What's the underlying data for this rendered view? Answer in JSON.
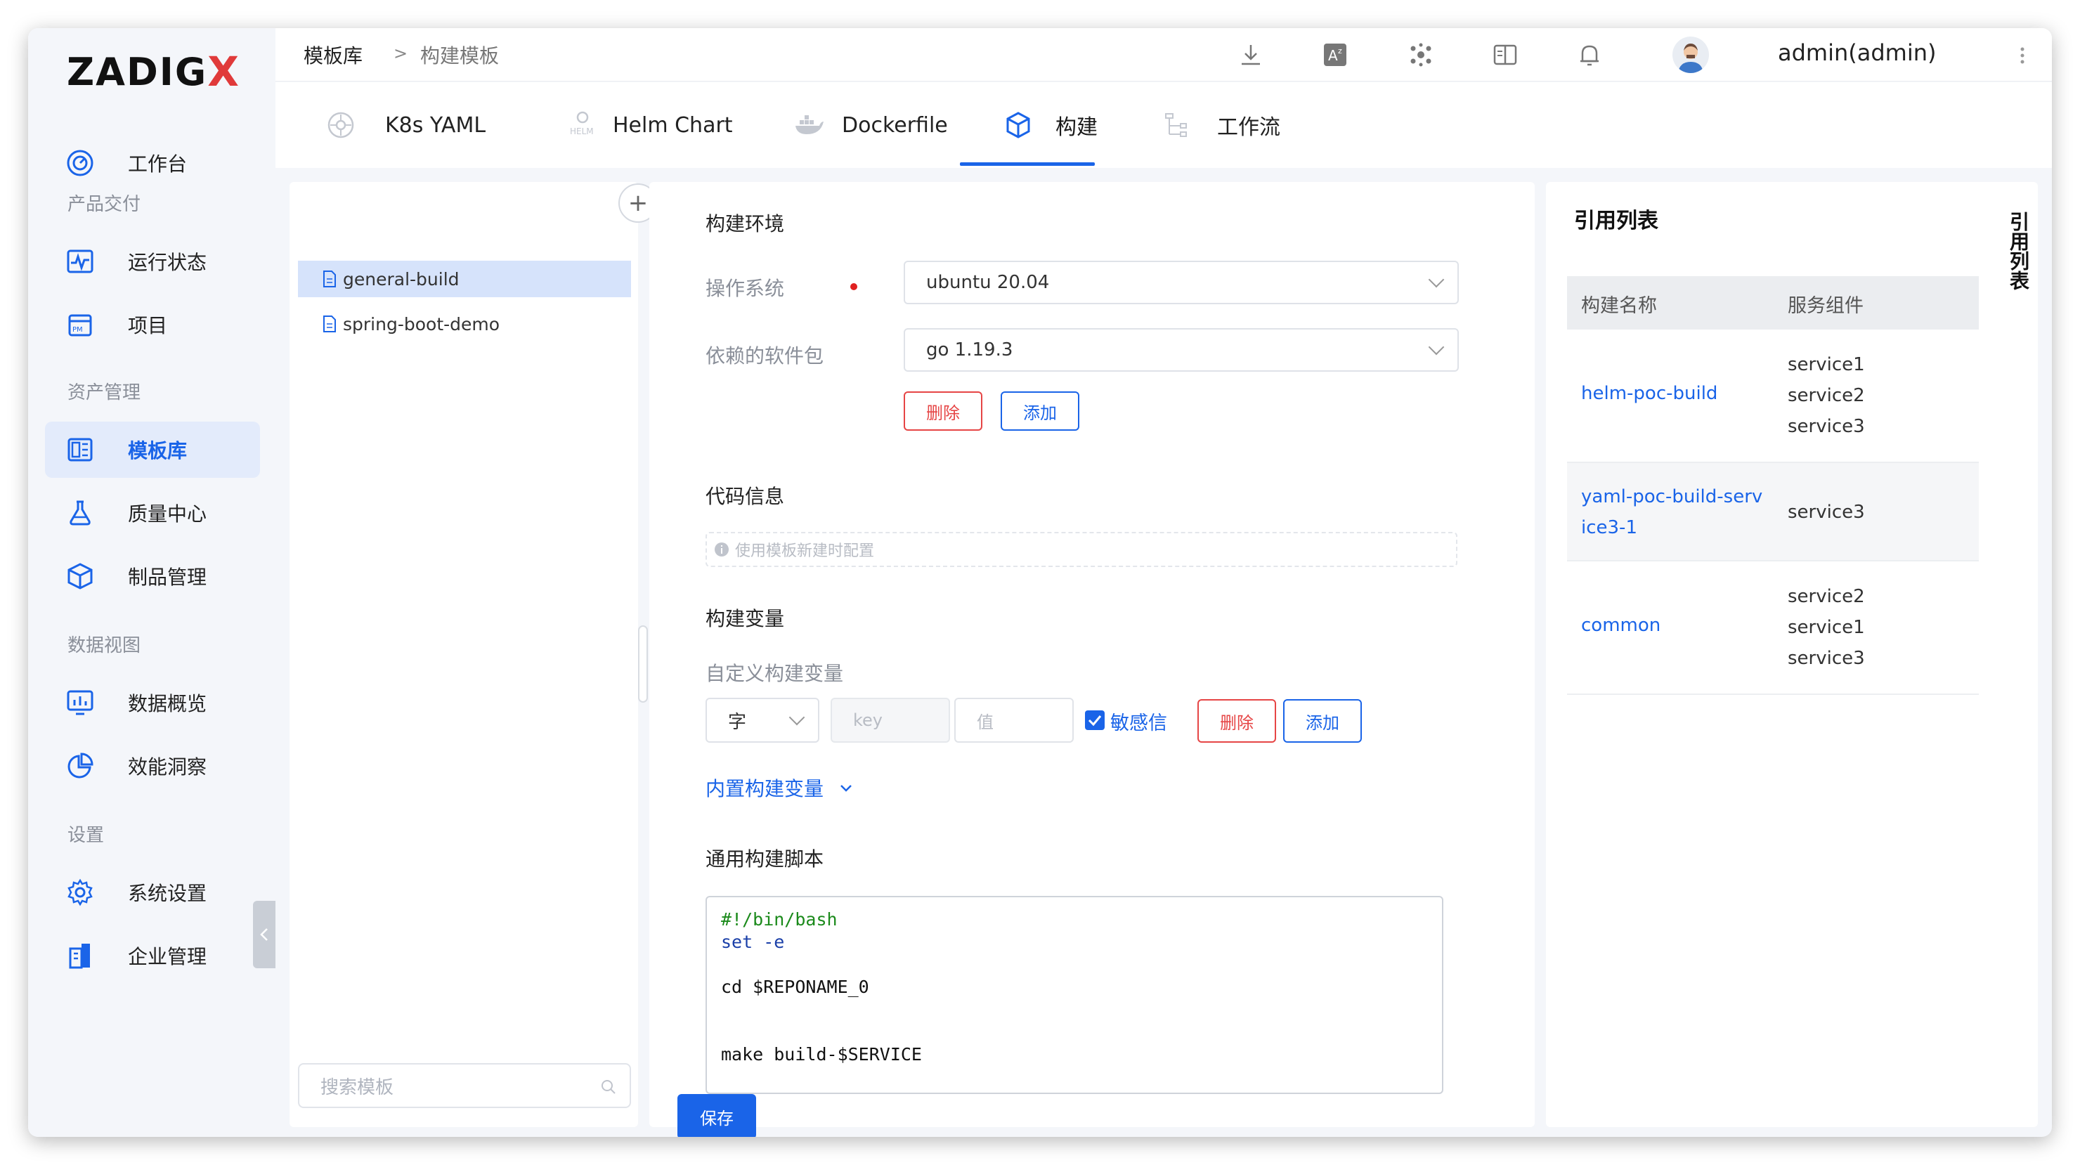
{
  "brand": {
    "logo_text": "ZADIG",
    "logo_x": "X"
  },
  "sidebar": {
    "items": [
      {
        "label": "工作台",
        "icon": "dashboard-icon"
      },
      {
        "section": "产品交付"
      },
      {
        "label": "运行状态",
        "icon": "pulse-icon"
      },
      {
        "label": "项目",
        "icon": "project-icon"
      },
      {
        "section": "资产管理"
      },
      {
        "label": "模板库",
        "icon": "template-icon",
        "active": true
      },
      {
        "label": "质量中心",
        "icon": "flask-icon"
      },
      {
        "label": "制品管理",
        "icon": "package-icon"
      },
      {
        "section": "数据视图"
      },
      {
        "label": "数据概览",
        "icon": "chart-icon"
      },
      {
        "label": "效能洞察",
        "icon": "pie-icon"
      },
      {
        "section": "设置"
      },
      {
        "label": "系统设置",
        "icon": "gear-icon"
      },
      {
        "label": "企业管理",
        "icon": "building-icon"
      }
    ]
  },
  "topbar": {
    "breadcrumb": [
      "模板库",
      ">",
      "构建模板"
    ],
    "user": "admin(admin)"
  },
  "tabs": [
    {
      "label": "K8s YAML",
      "icon": "k8s-icon"
    },
    {
      "label": "Helm Chart",
      "icon": "helm-icon"
    },
    {
      "label": "Dockerfile",
      "icon": "docker-icon"
    },
    {
      "label": "构建",
      "icon": "cube-icon",
      "active": true
    },
    {
      "label": "工作流",
      "icon": "workflow-icon"
    }
  ],
  "templates": {
    "add_symbol": "+",
    "items": [
      "general-build",
      "spring-boot-demo"
    ],
    "search_placeholder": "搜索模板"
  },
  "form": {
    "env_title": "构建环境",
    "os_label": "操作系统",
    "os_value": "ubuntu 20.04",
    "deps_label": "依赖的软件包",
    "deps_value": "go 1.19.3",
    "delete_label": "删除",
    "add_label": "添加",
    "code_title": "代码信息",
    "code_hint": "使用模板新建时配置",
    "vars_title": "构建变量",
    "custom_vars_label": "自定义构建变量",
    "var_type": "字",
    "var_key_placeholder": "key",
    "var_value_placeholder": "值",
    "sensitive_label": "敏感信",
    "builtin_vars_label": "内置构建变量",
    "script_title": "通用构建脚本",
    "script_lines": [
      "#!/bin/bash",
      "set -e",
      "",
      "cd $REPONAME_0",
      "",
      "",
      "make build-$SERVICE"
    ],
    "save_label": "保存"
  },
  "references": {
    "title": "引用列表",
    "side_tab": "引用列表",
    "headers": [
      "构建名称",
      "服务组件"
    ],
    "rows": [
      {
        "name": "helm-poc-build",
        "services": [
          "service1",
          "service2",
          "service3"
        ]
      },
      {
        "name": "yaml-poc-build-serv ice3-1",
        "name_lines": [
          "yaml-poc-build-serv",
          "ice3-1"
        ],
        "services": [
          "service3"
        ]
      },
      {
        "name": "common",
        "services": [
          "service2",
          "service1",
          "service3"
        ]
      }
    ]
  },
  "colors": {
    "accent": "#1a64e8",
    "danger": "#e64545",
    "active_bg": "#e3ebfb",
    "link": "#1a64e8"
  }
}
